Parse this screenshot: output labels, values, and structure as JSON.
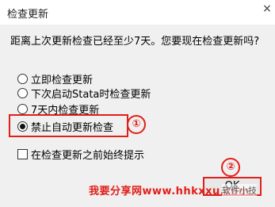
{
  "window": {
    "title": "检查更新",
    "close_glyph": "×"
  },
  "dialog": {
    "question": "距离上次更新检查已经至少7天。您要现在检查更新吗?",
    "options": [
      {
        "label": "立即检查更新",
        "checked": false
      },
      {
        "label": "下次启动Stata时检查更新",
        "checked": false
      },
      {
        "label": "7天内检查更新",
        "checked": false
      },
      {
        "label": "禁止自动更新检查",
        "checked": true
      }
    ],
    "always_prompt": {
      "label": "在检查更新之前始终提示",
      "checked": false
    },
    "ok_label": "OK"
  },
  "annotations": {
    "marker_1": "①",
    "marker_2": "②",
    "highlight_color": "#e0201a"
  },
  "overlay": {
    "watermark": "我要分享网www.hhkxxu.com",
    "account": "软件小技"
  }
}
